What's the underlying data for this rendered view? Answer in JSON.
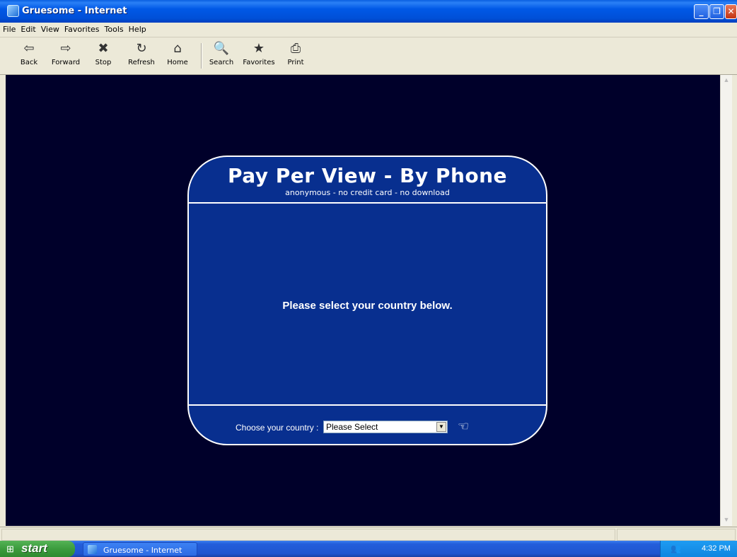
{
  "window": {
    "title": "Gruesome - Internet",
    "buttons": {
      "minimize": "_",
      "maximize": "❐",
      "close": "✕"
    }
  },
  "menu": [
    "File",
    "Edit",
    "View",
    "Favorites",
    "Tools",
    "Help"
  ],
  "toolbar": [
    {
      "label": "Back",
      "icon": "back-arrow-icon",
      "glyph": "⇦"
    },
    {
      "label": "Forward",
      "icon": "forward-arrow-icon",
      "glyph": "⇨"
    },
    {
      "label": "Stop",
      "icon": "stop-icon",
      "glyph": "✖"
    },
    {
      "label": "Refresh",
      "icon": "refresh-icon",
      "glyph": "↻"
    },
    {
      "label": "Home",
      "icon": "home-icon",
      "glyph": "⌂"
    },
    {
      "label": "Search",
      "icon": "search-icon",
      "glyph": "🔍"
    },
    {
      "label": "Favorites",
      "icon": "favorites-icon",
      "glyph": "★"
    },
    {
      "label": "Print",
      "icon": "print-icon",
      "glyph": "⎙"
    }
  ],
  "page": {
    "heading": "Pay Per View - By Phone",
    "subheading": "anonymous - no credit card - no download",
    "message": "Please select your country below.",
    "country_label": "Choose your country :",
    "country_select": "Please Select",
    "pointer_glyph": "☜",
    "colors": {
      "page_bg": "#00002a",
      "panel_bg": "#082f8f",
      "panel_border": "#ffffff"
    }
  },
  "taskbar": {
    "start_label": "start",
    "task_label": "Gruesome - Internet",
    "clock": "4:32 PM"
  }
}
